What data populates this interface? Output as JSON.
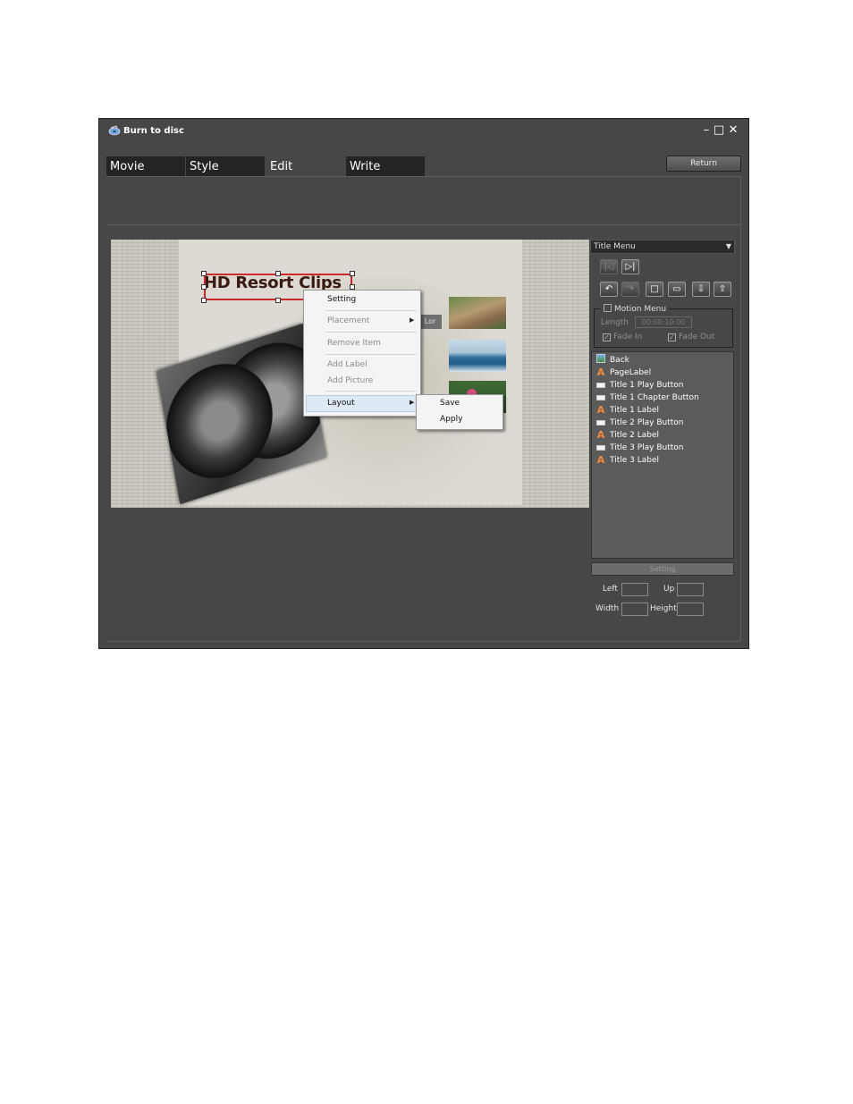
{
  "window": {
    "title": "Burn to disc",
    "controls": {
      "minimize": "–",
      "maximize": "□",
      "close": "✕"
    }
  },
  "tabs": [
    {
      "label": "Movie",
      "active": false
    },
    {
      "label": "Style",
      "active": false
    },
    {
      "label": "Edit",
      "active": true
    },
    {
      "label": "Write",
      "active": false
    }
  ],
  "return_label": "Return",
  "canvas": {
    "title_text": "HD Resort Clips",
    "chip_text": "Lor"
  },
  "context_menu": {
    "items": [
      {
        "label": "Setting",
        "enabled": true,
        "submenu": false
      },
      {
        "label": "Placement",
        "enabled": false,
        "submenu": true
      },
      {
        "label": "Remove Item",
        "enabled": false,
        "submenu": false
      },
      {
        "label": "Add Label",
        "enabled": false,
        "submenu": false
      },
      {
        "label": "Add Picture",
        "enabled": false,
        "submenu": false
      },
      {
        "label": "Layout",
        "enabled": true,
        "submenu": true,
        "highlighted": true
      }
    ],
    "layout_submenu": [
      "Save",
      "Apply"
    ]
  },
  "right_panel": {
    "menu_select": "Title Menu",
    "nav_icons": [
      "prev-page-icon",
      "next-page-icon"
    ],
    "tool_icons": [
      "undo-icon",
      "redo-icon",
      "safe-area-icon",
      "tv-preview-icon",
      "import-icon",
      "export-icon"
    ],
    "motion_menu": {
      "label": "Motion Menu",
      "checked": false,
      "length_label": "Length",
      "length_value": "00:00:10:00",
      "fade_in_label": "Fade In",
      "fade_in": true,
      "fade_out_label": "Fade Out",
      "fade_out": true
    },
    "items": [
      {
        "icon": "background",
        "label": "Back"
      },
      {
        "icon": "text",
        "label": "PageLabel"
      },
      {
        "icon": "button",
        "label": "Title 1 Play Button"
      },
      {
        "icon": "button",
        "label": "Title 1 Chapter Button"
      },
      {
        "icon": "text",
        "label": "Title 1 Label"
      },
      {
        "icon": "button",
        "label": "Title 2 Play Button"
      },
      {
        "icon": "text",
        "label": "Title 2 Label"
      },
      {
        "icon": "button",
        "label": "Title 3 Play Button"
      },
      {
        "icon": "text",
        "label": "Title 3 Label"
      }
    ],
    "setting_label": "Setting",
    "fields": {
      "left": "Left",
      "up": "Up",
      "width": "Width",
      "height": "Height"
    }
  },
  "colors": {
    "window_bg": "#474747",
    "tab_bg": "#242424",
    "selection": "#cc2a2a",
    "text_icon": "#f28a3a"
  }
}
